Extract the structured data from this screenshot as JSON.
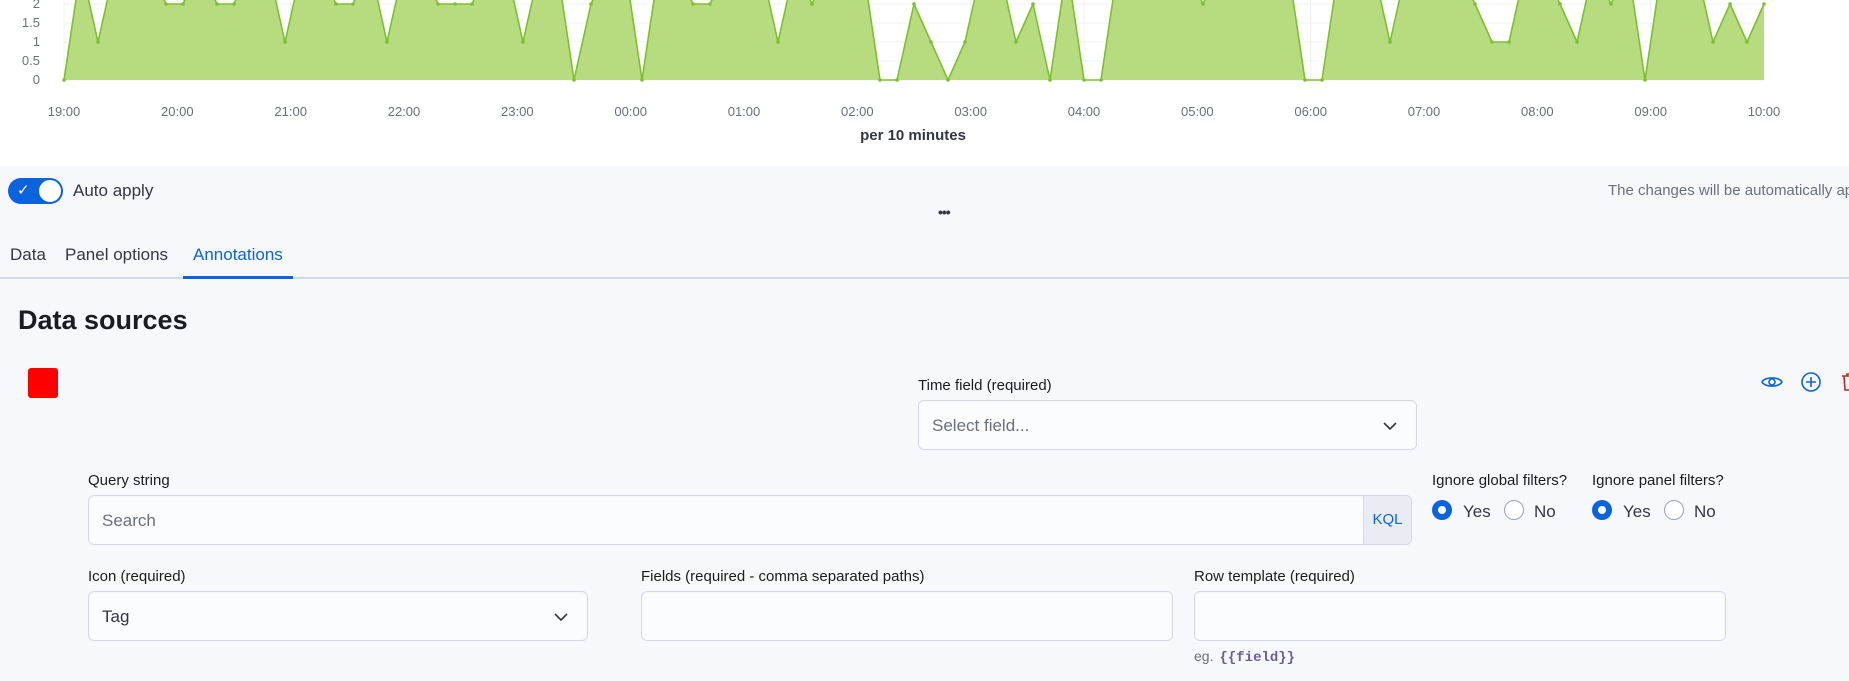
{
  "chart_data": {
    "type": "area",
    "xlabel": "per 10 minutes",
    "x_ticks": [
      "19:00",
      "20:00",
      "21:00",
      "22:00",
      "23:00",
      "00:00",
      "01:00",
      "02:00",
      "03:00",
      "04:00",
      "05:00",
      "06:00",
      "07:00",
      "08:00",
      "09:00",
      "10:00"
    ],
    "y_ticks": [
      "0",
      "0.5",
      "1",
      "1.5",
      "2"
    ],
    "ylim": [
      0,
      2.5
    ],
    "color": "#b6dc7f",
    "line_color": "#7cc02e",
    "series": [
      {
        "values": [
          0,
          3,
          1,
          3,
          3,
          3,
          2,
          2,
          3,
          2,
          2,
          3,
          3,
          1,
          3,
          3,
          2,
          2,
          3,
          1,
          3,
          3,
          2,
          2,
          2,
          3,
          3,
          1,
          3,
          3,
          0,
          2,
          3,
          3,
          0,
          3,
          3,
          2,
          2,
          3,
          3,
          3,
          1,
          3,
          2,
          3,
          3,
          3,
          0,
          0,
          2,
          1,
          0,
          1,
          3,
          3,
          1,
          2,
          0,
          3,
          0,
          0,
          3,
          3,
          3,
          3,
          3,
          2,
          3,
          3,
          3,
          3,
          3,
          0,
          0,
          3,
          3,
          3,
          1,
          3,
          3,
          3,
          3,
          2,
          1,
          1,
          3,
          3,
          2,
          1,
          3,
          2,
          3,
          0,
          3,
          3,
          3,
          1,
          2,
          1,
          2
        ]
      }
    ]
  },
  "toolbar": {
    "auto_apply_label": "Auto apply",
    "auto_apply_hint": "The changes will be automatically ap",
    "handle": "•••"
  },
  "tabs": [
    {
      "label": "Data"
    },
    {
      "label": "Panel options"
    },
    {
      "label": "Annotations"
    }
  ],
  "section": {
    "title": "Data sources",
    "swatch_color": "#ff0000"
  },
  "form": {
    "time_field": {
      "label": "Time field (required)",
      "placeholder": "Select field..."
    },
    "query": {
      "label": "Query string",
      "placeholder": "Search",
      "language": "KQL"
    },
    "ignore_global": {
      "label": "Ignore global filters?",
      "yes": "Yes",
      "no": "No",
      "selected": "Yes"
    },
    "ignore_panel": {
      "label": "Ignore panel filters?",
      "yes": "Yes",
      "no": "No",
      "selected": "Yes"
    },
    "icon": {
      "label": "Icon (required)",
      "value": "Tag"
    },
    "fields": {
      "label": "Fields (required - comma separated paths)",
      "value": ""
    },
    "row_template": {
      "label": "Row template (required)",
      "value": "",
      "hint_prefix": "eg.",
      "hint_code": "{{field}}"
    }
  },
  "icons": [
    "eye-icon",
    "plus-circle-icon",
    "trash-icon",
    "chevron-down-icon",
    "check-icon"
  ]
}
